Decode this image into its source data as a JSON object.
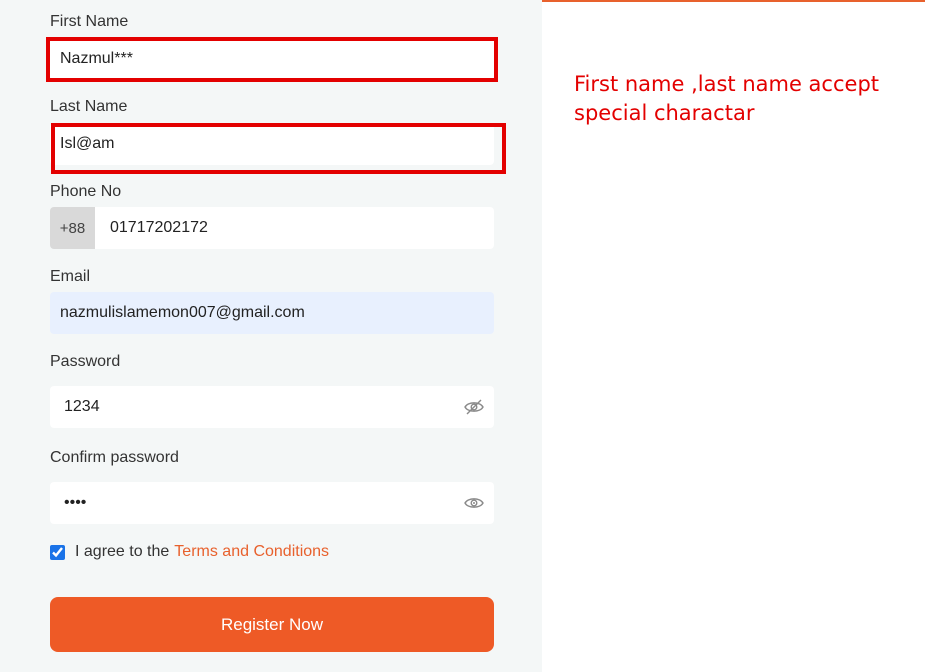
{
  "form": {
    "first_name": {
      "label": "First Name",
      "value": "Nazmul***"
    },
    "last_name": {
      "label": "Last Name",
      "value": "Isl@am"
    },
    "phone": {
      "label": "Phone No",
      "prefix": "+88",
      "value": "01717202172"
    },
    "email": {
      "label": "Email",
      "value": "nazmulislamemon007@gmail.com"
    },
    "password": {
      "label": "Password",
      "value": "1234"
    },
    "confirm_password": {
      "label": "Confirm password",
      "value": "1234"
    },
    "terms": {
      "text": "I agree to the",
      "link": "Terms and Conditions",
      "checked": true
    },
    "submit_label": "Register Now"
  },
  "annotation": {
    "text": "First name ,last name accept special charactar",
    "color": "#e30000"
  },
  "colors": {
    "accent": "#ee5a26",
    "panel_bg": "#f4f7f7",
    "autofill_bg": "#e8f0fe"
  },
  "icons": {
    "password_toggle": "eye-slash-icon",
    "confirm_toggle": "eye-icon"
  }
}
